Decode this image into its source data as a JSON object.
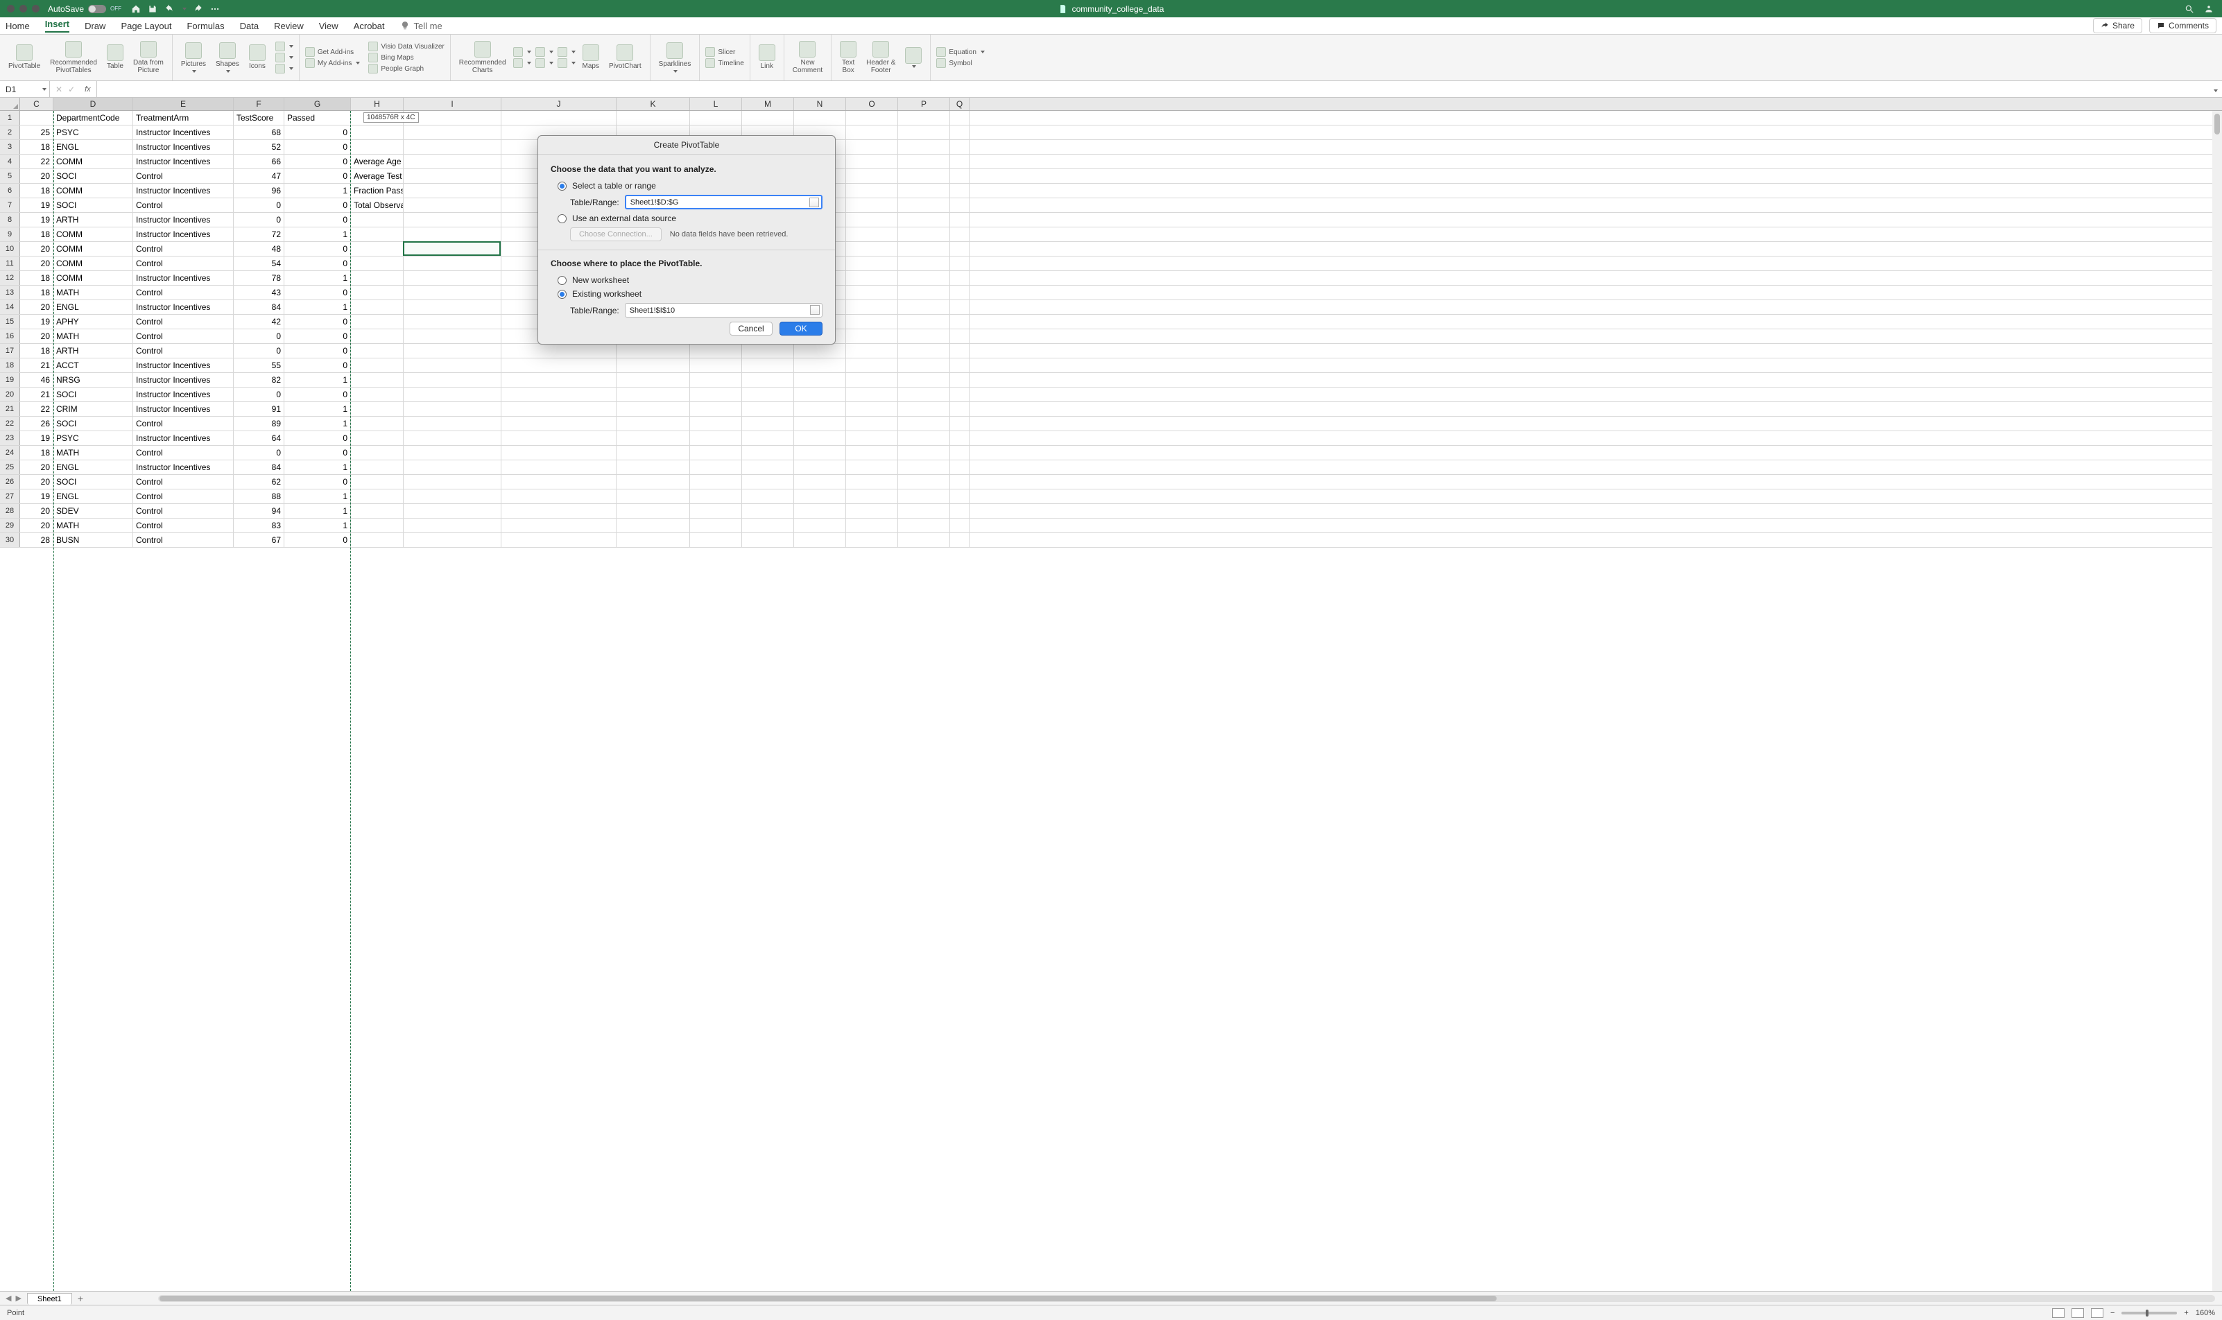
{
  "titlebar": {
    "autosave_label": "AutoSave",
    "autosave_state": "OFF",
    "doc_title": "community_college_data"
  },
  "ribbon_tabs": [
    "Home",
    "Insert",
    "Draw",
    "Page Layout",
    "Formulas",
    "Data",
    "Review",
    "View",
    "Acrobat"
  ],
  "ribbon_active": "Insert",
  "tell_me": "Tell me",
  "share": "Share",
  "comments": "Comments",
  "ribbon": {
    "pivot": "PivotTable",
    "recpivot": "Recommended\nPivotTables",
    "table": "Table",
    "datafrompic": "Data from\nPicture",
    "pictures": "Pictures",
    "shapes": "Shapes",
    "icons": "Icons",
    "getaddins": "Get Add-ins",
    "myaddins": "My Add-ins",
    "visio": "Visio Data Visualizer",
    "bingmaps": "Bing Maps",
    "peoplegraph": "People Graph",
    "reccharts": "Recommended\nCharts",
    "maps": "Maps",
    "pivotchart": "PivotChart",
    "sparklines": "Sparklines",
    "slicer": "Slicer",
    "timeline": "Timeline",
    "link": "Link",
    "newcomment": "New\nComment",
    "textbox": "Text\nBox",
    "headerfooter": "Header &\nFooter",
    "equation": "Equation",
    "symbol": "Symbol"
  },
  "namebox": "D1",
  "fx_label": "fx",
  "columns": [
    "C",
    "D",
    "E",
    "F",
    "G",
    "H",
    "I",
    "J",
    "K",
    "L",
    "M",
    "N",
    "O",
    "P",
    "Q"
  ],
  "headers": {
    "D": "DepartmentCode",
    "E": "TreatmentArm",
    "F": "TestScore",
    "G": "Passed"
  },
  "side_labels": {
    "4": "Average Age",
    "5": "Average Test Score",
    "6": "Fraction Passed",
    "7": "Total Observations"
  },
  "selection_tip": "1048576R x 4C",
  "rows": [
    {
      "r": 2,
      "C": 25,
      "D": "PSYC",
      "E": "Instructor Incentives",
      "F": 68,
      "G": 0
    },
    {
      "r": 3,
      "C": 18,
      "D": "ENGL",
      "E": "Instructor Incentives",
      "F": 52,
      "G": 0
    },
    {
      "r": 4,
      "C": 22,
      "D": "COMM",
      "E": "Instructor Incentives",
      "F": 66,
      "G": 0
    },
    {
      "r": 5,
      "C": 20,
      "D": "SOCI",
      "E": "Control",
      "F": 47,
      "G": 0
    },
    {
      "r": 6,
      "C": 18,
      "D": "COMM",
      "E": "Instructor Incentives",
      "F": 96,
      "G": 1
    },
    {
      "r": 7,
      "C": 19,
      "D": "SOCI",
      "E": "Control",
      "F": 0,
      "G": 0
    },
    {
      "r": 8,
      "C": 19,
      "D": "ARTH",
      "E": "Instructor Incentives",
      "F": 0,
      "G": 0
    },
    {
      "r": 9,
      "C": 18,
      "D": "COMM",
      "E": "Instructor Incentives",
      "F": 72,
      "G": 1
    },
    {
      "r": 10,
      "C": 20,
      "D": "COMM",
      "E": "Control",
      "F": 48,
      "G": 0
    },
    {
      "r": 11,
      "C": 20,
      "D": "COMM",
      "E": "Control",
      "F": 54,
      "G": 0
    },
    {
      "r": 12,
      "C": 18,
      "D": "COMM",
      "E": "Instructor Incentives",
      "F": 78,
      "G": 1
    },
    {
      "r": 13,
      "C": 18,
      "D": "MATH",
      "E": "Control",
      "F": 43,
      "G": 0
    },
    {
      "r": 14,
      "C": 20,
      "D": "ENGL",
      "E": "Instructor Incentives",
      "F": 84,
      "G": 1
    },
    {
      "r": 15,
      "C": 19,
      "D": "APHY",
      "E": "Control",
      "F": 42,
      "G": 0
    },
    {
      "r": 16,
      "C": 20,
      "D": "MATH",
      "E": "Control",
      "F": 0,
      "G": 0
    },
    {
      "r": 17,
      "C": 18,
      "D": "ARTH",
      "E": "Control",
      "F": 0,
      "G": 0
    },
    {
      "r": 18,
      "C": 21,
      "D": "ACCT",
      "E": "Instructor Incentives",
      "F": 55,
      "G": 0
    },
    {
      "r": 19,
      "C": 46,
      "D": "NRSG",
      "E": "Instructor Incentives",
      "F": 82,
      "G": 1
    },
    {
      "r": 20,
      "C": 21,
      "D": "SOCI",
      "E": "Instructor Incentives",
      "F": 0,
      "G": 0
    },
    {
      "r": 21,
      "C": 22,
      "D": "CRIM",
      "E": "Instructor Incentives",
      "F": 91,
      "G": 1
    },
    {
      "r": 22,
      "C": 26,
      "D": "SOCI",
      "E": "Control",
      "F": 89,
      "G": 1
    },
    {
      "r": 23,
      "C": 19,
      "D": "PSYC",
      "E": "Instructor Incentives",
      "F": 64,
      "G": 0
    },
    {
      "r": 24,
      "C": 18,
      "D": "MATH",
      "E": "Control",
      "F": 0,
      "G": 0
    },
    {
      "r": 25,
      "C": 20,
      "D": "ENGL",
      "E": "Instructor Incentives",
      "F": 84,
      "G": 1
    },
    {
      "r": 26,
      "C": 20,
      "D": "SOCI",
      "E": "Control",
      "F": 62,
      "G": 0
    },
    {
      "r": 27,
      "C": 19,
      "D": "ENGL",
      "E": "Control",
      "F": 88,
      "G": 1
    },
    {
      "r": 28,
      "C": 20,
      "D": "SDEV",
      "E": "Control",
      "F": 94,
      "G": 1
    },
    {
      "r": 29,
      "C": 20,
      "D": "MATH",
      "E": "Control",
      "F": 83,
      "G": 1
    },
    {
      "r": 30,
      "C": 28,
      "D": "BUSN",
      "E": "Control",
      "F": 67,
      "G": 0
    }
  ],
  "dialog": {
    "title": "Create PivotTable",
    "choose_data": "Choose the data that you want to analyze.",
    "select_range": "Select a table or range",
    "table_range_lbl": "Table/Range:",
    "table_range_val": "Sheet1!$D:$G",
    "external": "Use an external data source",
    "choose_conn": "Choose Connection...",
    "no_data": "No data fields have been retrieved.",
    "choose_place": "Choose where to place the PivotTable.",
    "new_ws": "New worksheet",
    "existing_ws": "Existing worksheet",
    "loc_val": "Sheet1!$I$10",
    "cancel": "Cancel",
    "ok": "OK"
  },
  "sheet_tab": "Sheet1",
  "status_mode": "Point",
  "zoom": "160%"
}
